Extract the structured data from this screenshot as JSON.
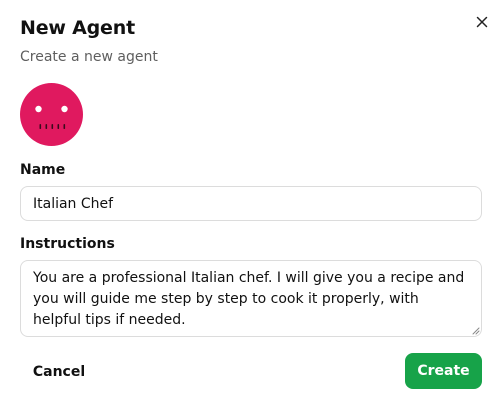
{
  "dialog": {
    "title": "New Agent",
    "subtitle": "Create a new agent",
    "close_icon": "close-icon"
  },
  "avatar": {
    "icon": "robot-face-icon",
    "color": "#e0195f"
  },
  "form": {
    "name_label": "Name",
    "name_value": "Italian Chef",
    "instructions_label": "Instructions",
    "instructions_value": "You are a professional Italian chef. I will give you a recipe and you will guide me step by step to cook it properly, with helpful tips if needed."
  },
  "actions": {
    "cancel_label": "Cancel",
    "create_label": "Create",
    "create_color": "#17a349"
  }
}
